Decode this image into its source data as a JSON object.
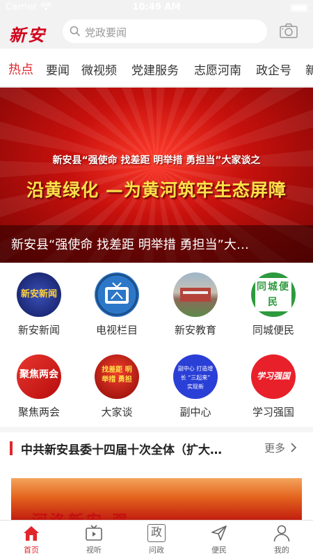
{
  "status_bar": {
    "carrier": "Carrier",
    "time": "10:49 AM"
  },
  "header": {
    "logo": "新安",
    "search_placeholder": "党政要闻"
  },
  "tabs": [
    {
      "label": "热点",
      "active": true
    },
    {
      "label": "要闻"
    },
    {
      "label": "微视频"
    },
    {
      "label": "党建服务"
    },
    {
      "label": "志愿河南"
    },
    {
      "label": "政企号"
    },
    {
      "label": "新"
    }
  ],
  "banner": {
    "subtitle": "新安县“强使命 找差距 明举措 勇担当”大家谈之",
    "main_title": "沿黄绿化 —为黄河筑牢生态屏障",
    "caption": "新安县“强使命 找差距 明举措 勇担当”大…"
  },
  "grid": [
    {
      "label": "新安新闻",
      "icon_text": "新安新闻"
    },
    {
      "label": "电视栏目"
    },
    {
      "label": "新安教育"
    },
    {
      "label": "同城便民",
      "icon_text": "同城便民"
    },
    {
      "label": "聚焦两会",
      "icon_text": "聚焦两会"
    },
    {
      "label": "大家谈",
      "icon_text": "找差距 明举措 勇担"
    },
    {
      "label": "副中心",
      "icon_text": "副中心 打造增长 “三起来” 实现新"
    },
    {
      "label": "学习强国",
      "icon_text": "学习强国"
    }
  ],
  "headline": {
    "text": "中共新安县委十四届十次全体（扩大…",
    "more": "更多"
  },
  "news_image_text": "河洛新安 强…",
  "bottom_nav": [
    {
      "label": "首页",
      "icon": "home-icon",
      "active": true
    },
    {
      "label": "视听",
      "icon": "tv-icon"
    },
    {
      "label": "问政",
      "icon": "zheng-icon",
      "glyph": "政"
    },
    {
      "label": "便民",
      "icon": "send-icon"
    },
    {
      "label": "我的",
      "icon": "user-icon"
    }
  ],
  "colors": {
    "accent": "#e0262d",
    "banner_red": "#c8110d",
    "title_yellow": "#ffe14a"
  }
}
